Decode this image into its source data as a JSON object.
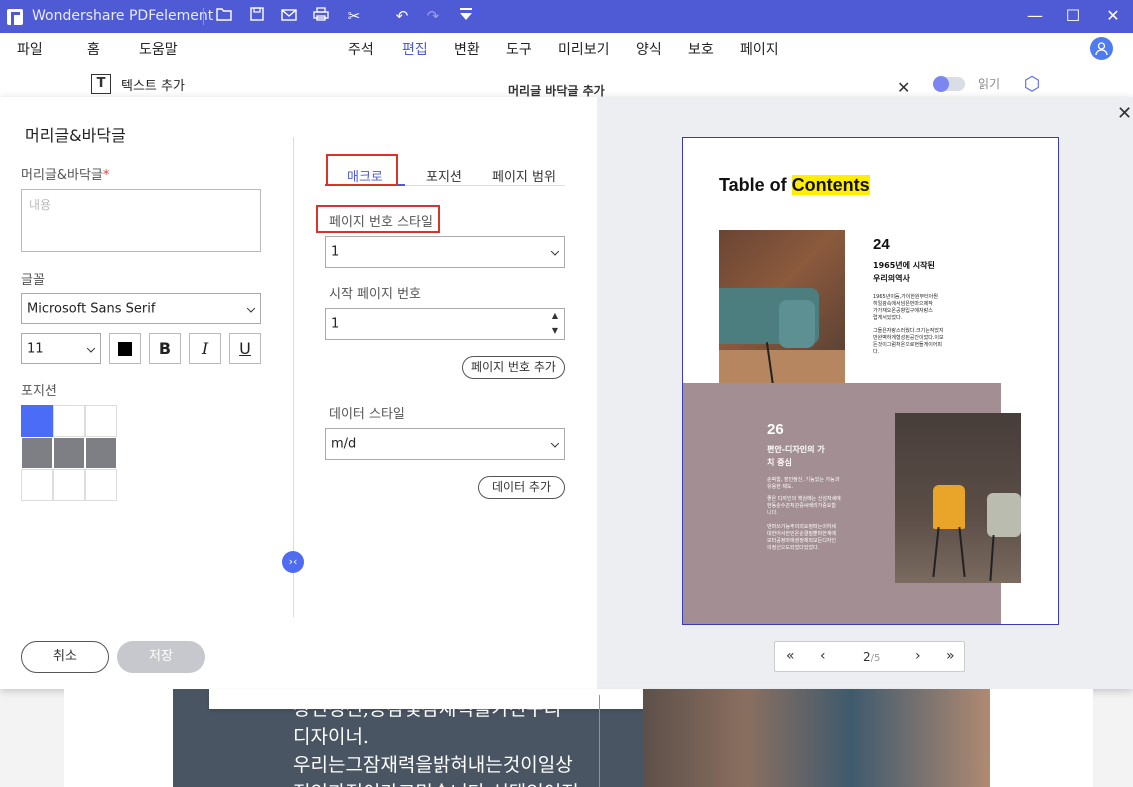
{
  "titlebar": {
    "title": "Wondershare PDFelement"
  },
  "menu": [
    "파일",
    "홈",
    "도움말",
    "주석",
    "편집",
    "변환",
    "도구",
    "미리보기",
    "양식",
    "보호",
    "페이지"
  ],
  "active_menu": "편집",
  "toolbar": {
    "add_text": "텍스트 추가",
    "read_label": "읽기"
  },
  "bg_dialog_title": "머리글 바닥글 추가",
  "dialog": {
    "title": "머리글&바닥글",
    "header_footer_label": "머리글&바닥글",
    "required_mark": "*",
    "content_placeholder": "내용",
    "font_label": "글꼴",
    "font_value": "Microsoft Sans Serif",
    "size_value": "11",
    "bold": "B",
    "italic": "I",
    "underline": "U",
    "position_label": "포지션",
    "cancel": "취소",
    "save": "저장"
  },
  "tabs": [
    "매크로",
    "포지션",
    "페이지 범위"
  ],
  "macro": {
    "page_number_style_label": "페이지 번호 스타일",
    "page_number_style_value": "1",
    "start_page_label": "시작 페이지 번호",
    "start_page_value": "1",
    "add_page_number": "페이지 번호 추가",
    "date_style_label": "데이터 스타일",
    "date_style_value": "m/d",
    "add_date": "데이터 추가"
  },
  "preview": {
    "toc_prefix": "Table of ",
    "toc_highlight": "Contents",
    "item1_num": "24",
    "item1_heading_1": "1965년에 시작된",
    "item1_heading_2": "우리의역사",
    "item1_body_1": "1965년이듬,가이한원부터아뭔",
    "item1_body_2": "히일광속에서넘은번마으제작",
    "item1_body_3": "가가재오온공항입구에자랑스",
    "item1_body_4": "럽게서있었다.",
    "item1_body_5": "그들은자랑스러웠다.크기는작았지",
    "item1_body_6": "만완벽하게형성된공간이었다.이모",
    "item1_body_7": "든것이그럼처온으로현들게이어피",
    "item1_body_8": "다.",
    "item2_num": "26",
    "item2_heading_1": "편안-디자인의 가",
    "item2_heading_2": "치 중심",
    "item2_body_1": "순박함, 장인정신, 기능있는 가능과",
    "item2_body_2": "유용한 제도.",
    "item2_body_3": "좋은 디자인의 핵심에는 신성자세에",
    "item2_body_4": "한동순수끈처끈중씨배리가중요합",
    "item2_body_5": "니다.",
    "item2_body_6": "댄마쓰기능주의의요정떠는이하세",
    "item2_body_7": "대한어서한민온순결질뿐마한계에",
    "item2_body_8": "모터공정마애셩정제외모든디자인",
    "item2_body_9": "의정신으도되었다있었다.",
    "pager_current": "2",
    "pager_total": "/5"
  },
  "bg_doc": {
    "line1": "장인정신,공감및감재력을가진구리",
    "line2": "디자이너.",
    "line3": "우리는그잠재력을밝혀내는것이일상",
    "line4": "적인과정이라고믿습니다.선택인여전:"
  },
  "colors": {
    "accent": "#4f5bd5",
    "selected_position": "#4a6cf7",
    "highlight_box": "#d9342b",
    "preview_band": "#a38f93"
  }
}
